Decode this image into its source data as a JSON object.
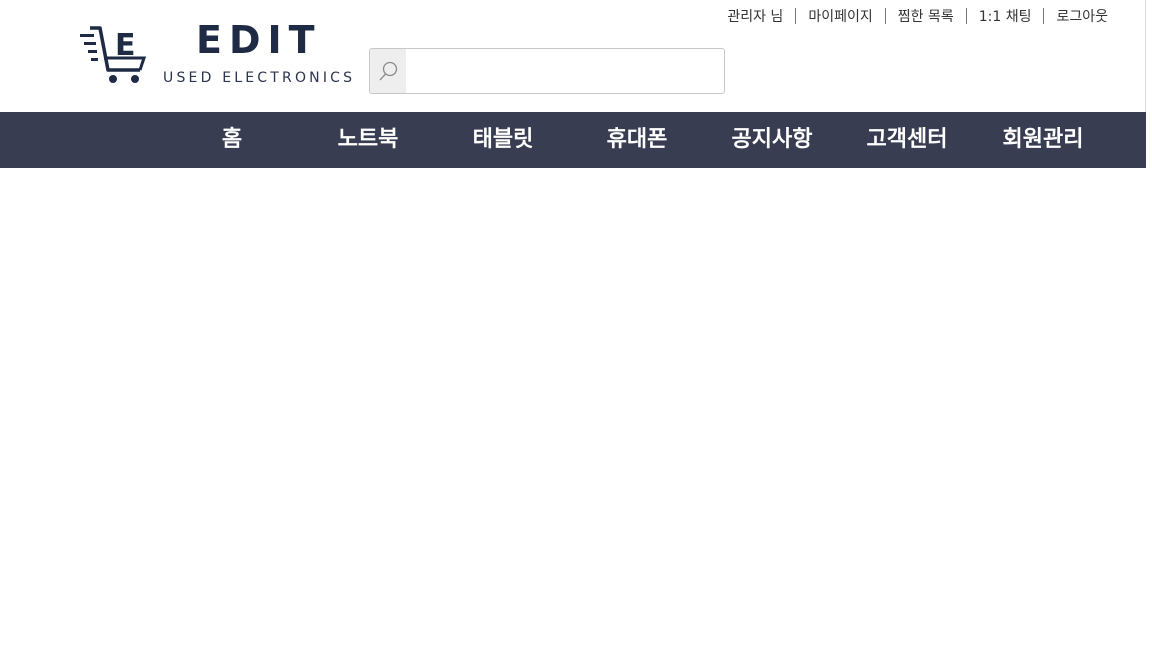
{
  "brand": {
    "name": "EDIT",
    "tagline": "USED ELECTRONICS",
    "logo_icon": "shopping-cart-icon",
    "colors": {
      "navy": "#1f2a44",
      "accent": "#f2b134"
    }
  },
  "search": {
    "placeholder": "",
    "value": "",
    "icon": "search-icon"
  },
  "utility_links": [
    {
      "label": "관리자 님"
    },
    {
      "label": "마이페이지"
    },
    {
      "label": "찜한 목록"
    },
    {
      "label": "1:1 채팅"
    },
    {
      "label": "로그아웃"
    }
  ],
  "nav": {
    "background": "#383d52",
    "items": [
      {
        "label": "홈"
      },
      {
        "label": "노트북"
      },
      {
        "label": "태블릿"
      },
      {
        "label": "휴대폰"
      },
      {
        "label": "공지사항"
      },
      {
        "label": "고객센터"
      },
      {
        "label": "회원관리"
      }
    ]
  }
}
